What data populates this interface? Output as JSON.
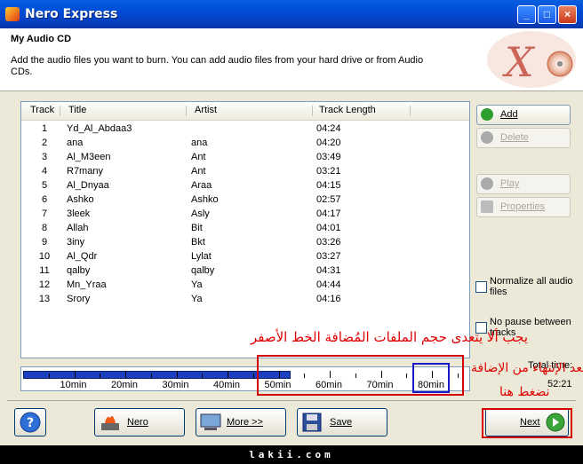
{
  "window": {
    "title": "Nero Express"
  },
  "header": {
    "title": "My Audio CD",
    "description": "Add the audio files you want to burn. You can add audio files from your hard drive or from Audio CDs."
  },
  "table": {
    "columns": [
      "Track",
      "Title",
      "Artist",
      "Track Length"
    ],
    "rows": [
      [
        "1",
        "Yd_Al_Abdaa3",
        "",
        "04:24"
      ],
      [
        "2",
        "ana",
        "ana",
        "04:20"
      ],
      [
        "3",
        "Al_M3een",
        "Ant",
        "03:49"
      ],
      [
        "4",
        "R7many",
        "Ant",
        "03:21"
      ],
      [
        "5",
        "Al_Dnyaa",
        "Araa",
        "04:15"
      ],
      [
        "6",
        "Ashko",
        "Ashko",
        "02:57"
      ],
      [
        "7",
        "3leek",
        "Asly",
        "04:17"
      ],
      [
        "8",
        "Allah",
        "Bit",
        "04:01"
      ],
      [
        "9",
        "3iny",
        "Bkt",
        "03:26"
      ],
      [
        "10",
        "Al_Qdr",
        "Lylat",
        "03:27"
      ],
      [
        "11",
        "qalby",
        "qalby",
        "04:31"
      ],
      [
        "12",
        "Mn_Yraa",
        "Ya",
        "04:44"
      ],
      [
        "13",
        "Srory",
        "Ya",
        "04:16"
      ]
    ]
  },
  "side_buttons": {
    "add": "Add",
    "delete": "Delete",
    "play": "Play",
    "properties": "Properties"
  },
  "options": {
    "normalize": "Normalize all audio files",
    "no_pause": "No pause between tracks"
  },
  "capacity": {
    "ticks": [
      "10min",
      "20min",
      "30min",
      "40min",
      "50min",
      "60min",
      "70min",
      "80min"
    ],
    "total_label": "Total time:",
    "total_time": "52:21",
    "filled_minutes": 52.35,
    "max_minutes": 86
  },
  "bottom_buttons": {
    "nero": "Nero",
    "more": "More >>",
    "save": "Save",
    "next": "Next"
  },
  "annotations": {
    "limit_note": "يجب ألا يتعدى حجم الملفات المُضافة الخط الأصفر",
    "after_add_line1": "بعد الإنتهاء من الإضافة",
    "after_add_line2": "نضغط هنا"
  },
  "footer": {
    "watermark": "lakii.com"
  },
  "colors": {
    "titlebar": "#0550d8",
    "annotation": "#e00000",
    "capacity_fill": "#1c3fbf"
  }
}
